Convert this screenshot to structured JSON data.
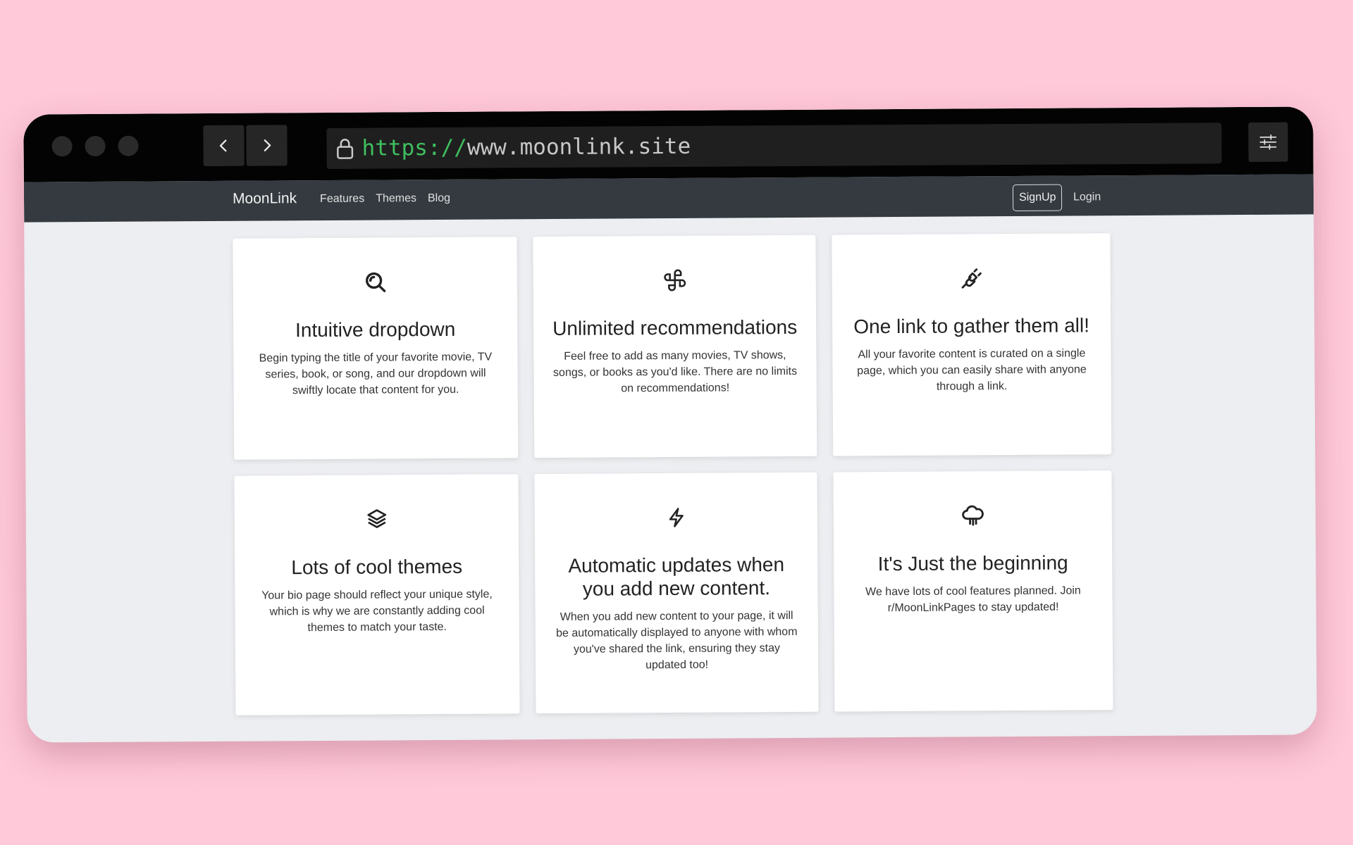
{
  "browser": {
    "url_protocol": "https://",
    "url_host": "www.moonlink.site",
    "icons": {
      "back": "chevron-left-icon",
      "forward": "chevron-right-icon",
      "lock": "lock-icon",
      "menu": "sliders-icon"
    }
  },
  "site_nav": {
    "brand": "MoonLink",
    "links": [
      "Features",
      "Themes",
      "Blog"
    ],
    "signup_label": "SignUp",
    "login_label": "Login"
  },
  "features": [
    {
      "icon": "search-icon",
      "title": "Intuitive dropdown",
      "text": "Begin typing the title of your favorite movie, TV series, book, or song, and our dropdown will swiftly locate that content for you."
    },
    {
      "icon": "pinwheel-icon",
      "title": "Unlimited recommendations",
      "text": "Feel free to add as many movies, TV shows, songs, or books as you'd like. There are no limits on recommendations!"
    },
    {
      "icon": "plug-link-icon",
      "title": "One link to gather them all!",
      "text": "All your favorite content is curated on a single page, which you can easily share with anyone through a link."
    },
    {
      "icon": "layers-icon",
      "title": "Lots of cool themes",
      "text": "Your bio page should reflect your unique style, which is why we are constantly adding cool themes to match your taste."
    },
    {
      "icon": "lightning-icon",
      "title": "Automatic updates when you add new content.",
      "text": "When you add new content to your page, it will be automatically displayed to anyone with whom you've shared the link, ensuring they stay updated too!"
    },
    {
      "icon": "cloud-icon",
      "title": "It's Just the beginning",
      "text": "We have lots of cool features planned. Join r/MoonLinkPages to stay updated!"
    }
  ],
  "colors": {
    "background": "#ffc9d9",
    "chrome": "#030303",
    "nav": "#343a40",
    "url_protocol": "#3fbf5f",
    "page": "#eceef1"
  }
}
